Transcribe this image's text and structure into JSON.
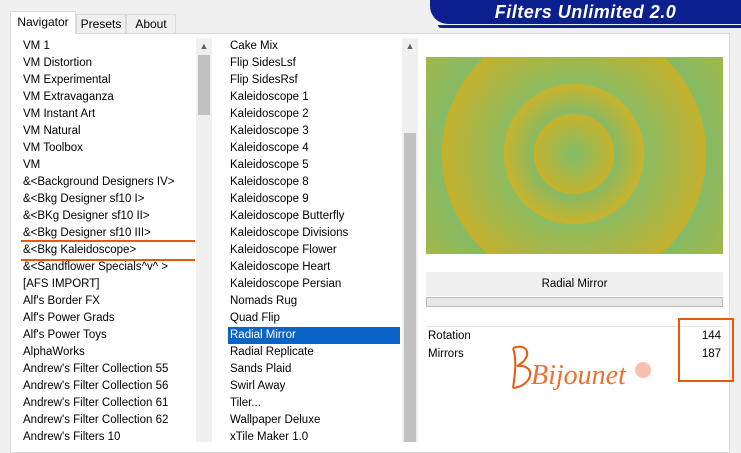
{
  "header": {
    "title": "Filters Unlimited 2.0"
  },
  "tabs": [
    {
      "label": "Navigator"
    },
    {
      "label": "Presets"
    },
    {
      "label": "About"
    }
  ],
  "categories": {
    "items": [
      "VM 1",
      "VM Distortion",
      "VM Experimental",
      "VM Extravaganza",
      "VM Instant Art",
      "VM Natural",
      "VM Toolbox",
      "VM",
      "&<Background Designers IV>",
      "&<Bkg Designer sf10 I>",
      "&<BKg Designer sf10 II>",
      "&<Bkg Designer sf10 III>",
      "&<Bkg Kaleidoscope>",
      "&<Sandflower Specials^v^ >",
      "[AFS IMPORT]",
      "Alf's Border FX",
      "Alf's Power Grads",
      "Alf's Power Toys",
      "AlphaWorks",
      "Andrew's Filter Collection 55",
      "Andrew's Filter Collection 56",
      "Andrew's Filter Collection 61",
      "Andrew's Filter Collection 62",
      "Andrew's Filters 10"
    ],
    "selected_index": 12
  },
  "filters": {
    "items": [
      "Cake Mix",
      "Flip SidesLsf",
      "Flip SidesRsf",
      "Kaleidoscope 1",
      "Kaleidoscope 2",
      "Kaleidoscope 3",
      "Kaleidoscope 4",
      "Kaleidoscope 5",
      "Kaleidoscope 8",
      "Kaleidoscope 9",
      "Kaleidoscope Butterfly",
      "Kaleidoscope Divisions",
      "Kaleidoscope Flower",
      "Kaleidoscope Heart",
      "Kaleidoscope Persian",
      "Nomads Rug",
      "Quad Flip",
      "Radial Mirror",
      "Radial Replicate",
      "Sands Plaid",
      "Swirl Away",
      "Tiler...",
      "Wallpaper Deluxe",
      "xTile Maker 1.0"
    ],
    "selected_index": 17
  },
  "filter_panel": {
    "name": "Radial Mirror",
    "params": [
      {
        "label": "Rotation",
        "value": "144"
      },
      {
        "label": "Mirrors",
        "value": "187"
      }
    ]
  },
  "signature": {
    "text": "Bijounet"
  },
  "colors": {
    "accent": "#0a64c8",
    "highlight": "#e8590c",
    "banner": "#0b1f8e"
  }
}
